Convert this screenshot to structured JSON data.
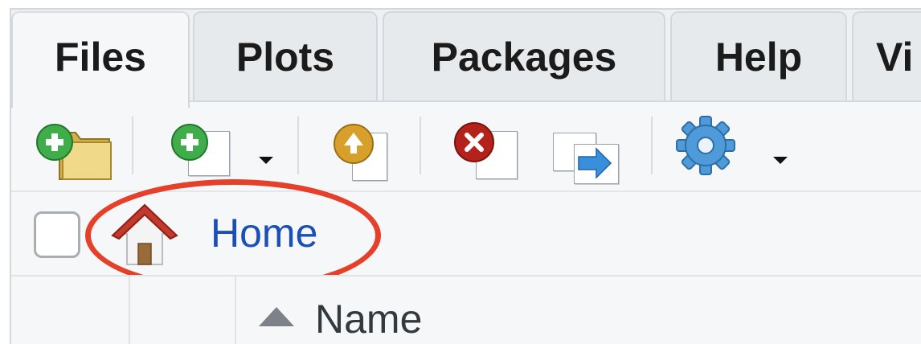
{
  "tabs": [
    {
      "label": "Files",
      "active": true
    },
    {
      "label": "Plots",
      "active": false
    },
    {
      "label": "Packages",
      "active": false
    },
    {
      "label": "Help",
      "active": false
    },
    {
      "label": "Vi",
      "active": false
    }
  ],
  "toolbar": {
    "icons": [
      "new-folder-icon",
      "new-file-icon",
      "upload-icon",
      "delete-icon",
      "rename-icon",
      "gear-icon"
    ],
    "colors": {
      "green": "#3fae4a",
      "gold": "#d6a02a",
      "red": "#b3231c",
      "blue": "#3a8fdc"
    }
  },
  "breadcrumb": {
    "home_label": "Home",
    "home_icon": "house-icon"
  },
  "table": {
    "sort_icon": "sort-ascending-icon",
    "name_header": "Name"
  },
  "annotation": {
    "color": "#e5402a",
    "shape": "ellipse"
  }
}
